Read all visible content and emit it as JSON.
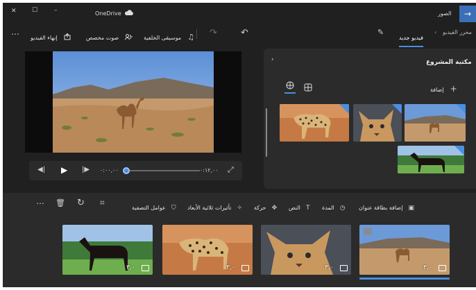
{
  "titlebar": {
    "app_name": "OneDrive",
    "minimize": "–",
    "maximize": "☐",
    "close": "✕"
  },
  "nav": {
    "back_label": "الصور",
    "tab_active": "فيديو جديد",
    "tab_inactive": "محرر الفيديو",
    "edit_icon": "pencil-icon"
  },
  "toolbar": {
    "finish": "إنهاء الفيديو",
    "custom_audio": "صوت مخصص",
    "background_music": "موسيقى الخلفية",
    "more": "⋯"
  },
  "library": {
    "title": "مكتبة المشروع",
    "add_label": "إضافة"
  },
  "player": {
    "time_start": "٠:٠٠,٠٠",
    "time_end": "٠:١٢,٠٠"
  },
  "timeline_toolbar": {
    "add_title_card": "إضافة بطاقة عنوان",
    "duration": "المدة",
    "text": "النص",
    "motion": "حركة",
    "effects_3d": "تأثيرات ثلاثية الأبعاد",
    "filters": "عوامل التصفية"
  },
  "storyboard": {
    "items": [
      {
        "duration": "٣,٠"
      },
      {
        "duration": "٣,٠"
      },
      {
        "duration": "٣,٠"
      },
      {
        "duration": "٣,٠"
      }
    ]
  },
  "colors": {
    "accent": "#4a8fe0",
    "background": "#202020",
    "panel": "#2b2b2b"
  }
}
